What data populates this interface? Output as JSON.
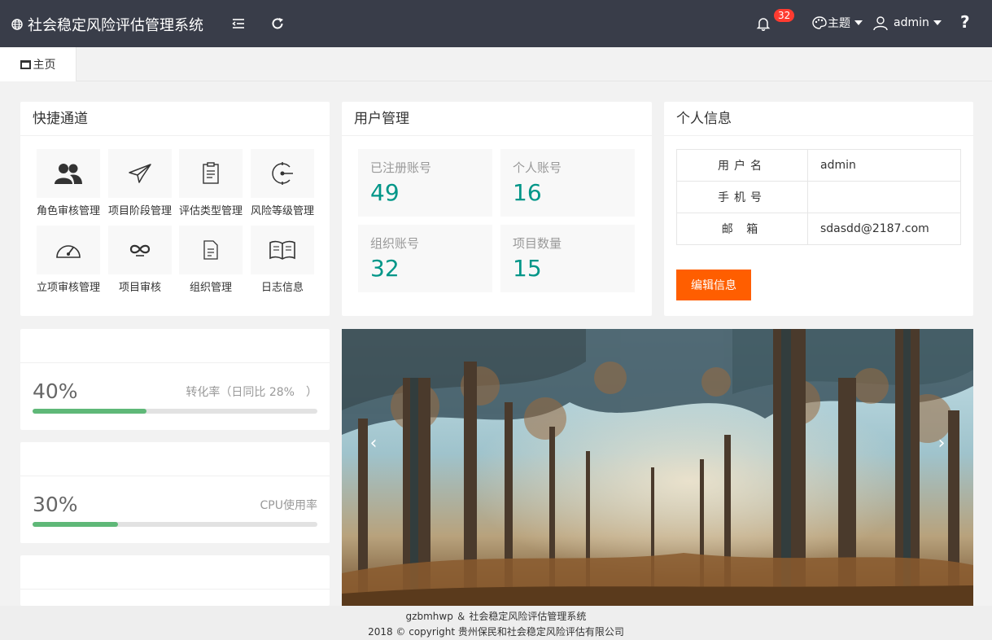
{
  "header": {
    "title": "社会稳定风险评估管理系统",
    "notifications": "32",
    "theme_label": "主题",
    "user_label": "admin",
    "help": "?"
  },
  "tabs": {
    "home": "主页"
  },
  "quick": {
    "title": "快捷通道",
    "items": [
      {
        "label": "角色审核管理",
        "icon": "users-icon"
      },
      {
        "label": "项目阶段管理",
        "icon": "paper-plane-icon"
      },
      {
        "label": "评估类型管理",
        "icon": "clipboard-icon"
      },
      {
        "label": "风险等级管理",
        "icon": "dial-icon"
      },
      {
        "label": "立项审核管理",
        "icon": "gauge-icon"
      },
      {
        "label": "项目审核",
        "icon": "infinity-icon"
      },
      {
        "label": "组织管理",
        "icon": "document-chart-icon"
      },
      {
        "label": "日志信息",
        "icon": "book-icon"
      }
    ]
  },
  "users": {
    "title": "用户管理",
    "stats": [
      {
        "label": "已注册账号",
        "value": "49"
      },
      {
        "label": "个人账号",
        "value": "16"
      },
      {
        "label": "组织账号",
        "value": "32"
      },
      {
        "label": "项目数量",
        "value": "15"
      }
    ]
  },
  "info": {
    "title": "个人信息",
    "rows": [
      {
        "key": "用户名",
        "value": "admin"
      },
      {
        "key": "手机号",
        "value": ""
      },
      {
        "key": "邮 箱",
        "value": "sdasdd@2187.com"
      }
    ],
    "edit_button": "编辑信息"
  },
  "progress": [
    {
      "percent_text": "40%",
      "desc": "转化率（日同比 28%　）",
      "fraction": 0.4
    },
    {
      "percent_text": "30%",
      "desc": "CPU使用率",
      "fraction": 0.3
    }
  ],
  "carousel": {
    "prev": "‹",
    "next": "›"
  },
  "footer": {
    "line1": "gzbmhwp ＆ 社会稳定风险评估管理系统",
    "line2": "2018 © copyright 贵州保民和社会稳定风险评估有限公司"
  },
  "colors": {
    "header_bg": "#393d49",
    "accent_green": "#009688",
    "progress_green": "#5fb878",
    "edit_orange": "#ff5e00",
    "badge_red": "#ff3b30"
  }
}
